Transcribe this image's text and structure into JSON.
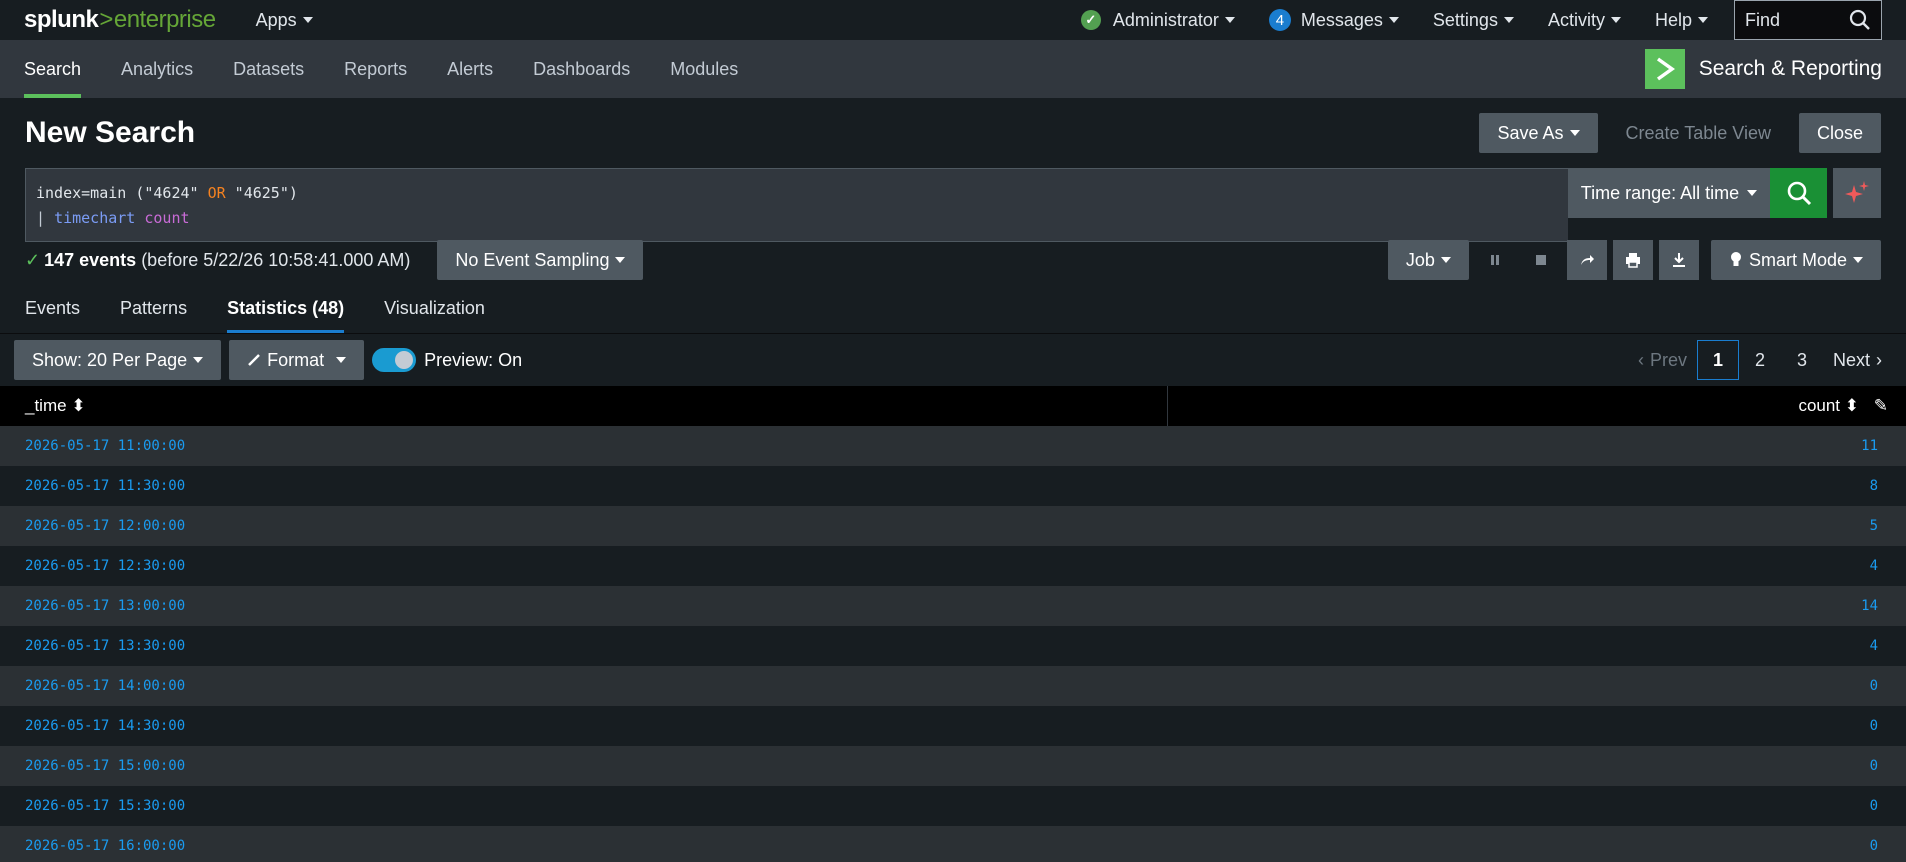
{
  "app": {
    "logo_splunk": "splunk",
    "logo_gt": ">",
    "logo_enterprise": "enterprise",
    "apps_label": "Apps",
    "admin_label": "Administrator",
    "messages_count": "4",
    "messages_label": "Messages",
    "settings_label": "Settings",
    "activity_label": "Activity",
    "help_label": "Help",
    "find_placeholder": "Find"
  },
  "nav": {
    "items": [
      {
        "label": "Search",
        "active": true
      },
      {
        "label": "Analytics"
      },
      {
        "label": "Datasets"
      },
      {
        "label": "Reports"
      },
      {
        "label": "Alerts"
      },
      {
        "label": "Dashboards"
      },
      {
        "label": "Modules"
      }
    ],
    "app_title": "Search & Reporting"
  },
  "page": {
    "title": "New Search",
    "save_as": "Save As",
    "create_table_view": "Create Table View",
    "close": "Close"
  },
  "search": {
    "line1_prefix": "index=main (\"4624\" ",
    "line1_or": "OR",
    "line1_suffix": " \"4625\")",
    "line2_pipe": "| ",
    "line2_cmd": "timechart",
    "line2_fn": "count",
    "time_range": "Time range: All time"
  },
  "status": {
    "events": "147 events",
    "before": "(before 5/22/26 10:58:41.000 AM)",
    "sampling": "No Event Sampling",
    "job": "Job",
    "smart_mode": "Smart Mode"
  },
  "tabs": [
    "Events",
    "Patterns",
    "Statistics (48)",
    "Visualization"
  ],
  "table_toolbar": {
    "show": "Show: 20 Per Page",
    "format": "Format",
    "preview": "Preview: On",
    "prev": "Prev",
    "pages": [
      "1",
      "2",
      "3"
    ],
    "next": "Next"
  },
  "table": {
    "columns": [
      "_time",
      "count"
    ],
    "rows": [
      [
        "2026-05-17 11:00:00",
        "11"
      ],
      [
        "2026-05-17 11:30:00",
        "8"
      ],
      [
        "2026-05-17 12:00:00",
        "5"
      ],
      [
        "2026-05-17 12:30:00",
        "4"
      ],
      [
        "2026-05-17 13:00:00",
        "14"
      ],
      [
        "2026-05-17 13:30:00",
        "4"
      ],
      [
        "2026-05-17 14:00:00",
        "0"
      ],
      [
        "2026-05-17 14:30:00",
        "0"
      ],
      [
        "2026-05-17 15:00:00",
        "0"
      ],
      [
        "2026-05-17 15:30:00",
        "0"
      ],
      [
        "2026-05-17 16:00:00",
        "0"
      ]
    ]
  },
  "colors": {
    "accent_green": "#5cc05c",
    "link_blue": "#1a9bf0",
    "search_green": "#1a9035"
  }
}
